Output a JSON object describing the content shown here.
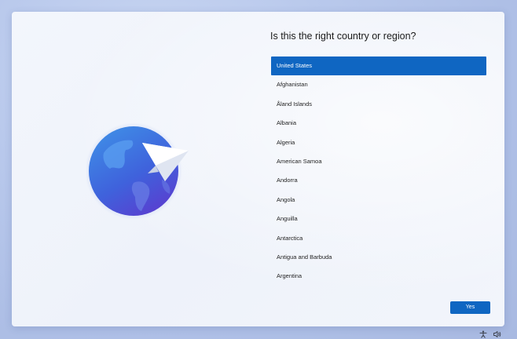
{
  "page": {
    "title": "Is this the right country or region?"
  },
  "regions": {
    "selected_index": 0,
    "items": [
      {
        "label": "United States"
      },
      {
        "label": "Afghanistan"
      },
      {
        "label": "Åland Islands"
      },
      {
        "label": "Albania"
      },
      {
        "label": "Algeria"
      },
      {
        "label": "American Samoa"
      },
      {
        "label": "Andorra"
      },
      {
        "label": "Angola"
      },
      {
        "label": "Anguilla"
      },
      {
        "label": "Antarctica"
      },
      {
        "label": "Antigua and Barbuda"
      },
      {
        "label": "Argentina"
      }
    ]
  },
  "actions": {
    "yes_label": "Yes"
  },
  "illustration": {
    "icon": "globe-paper-plane-icon"
  },
  "taskbar": {
    "icons": [
      "accessibility-icon",
      "volume-icon"
    ]
  },
  "colors": {
    "accent": "#0f66c2",
    "globe_top": "#3f8de6",
    "globe_bottom": "#5b3ccf"
  }
}
